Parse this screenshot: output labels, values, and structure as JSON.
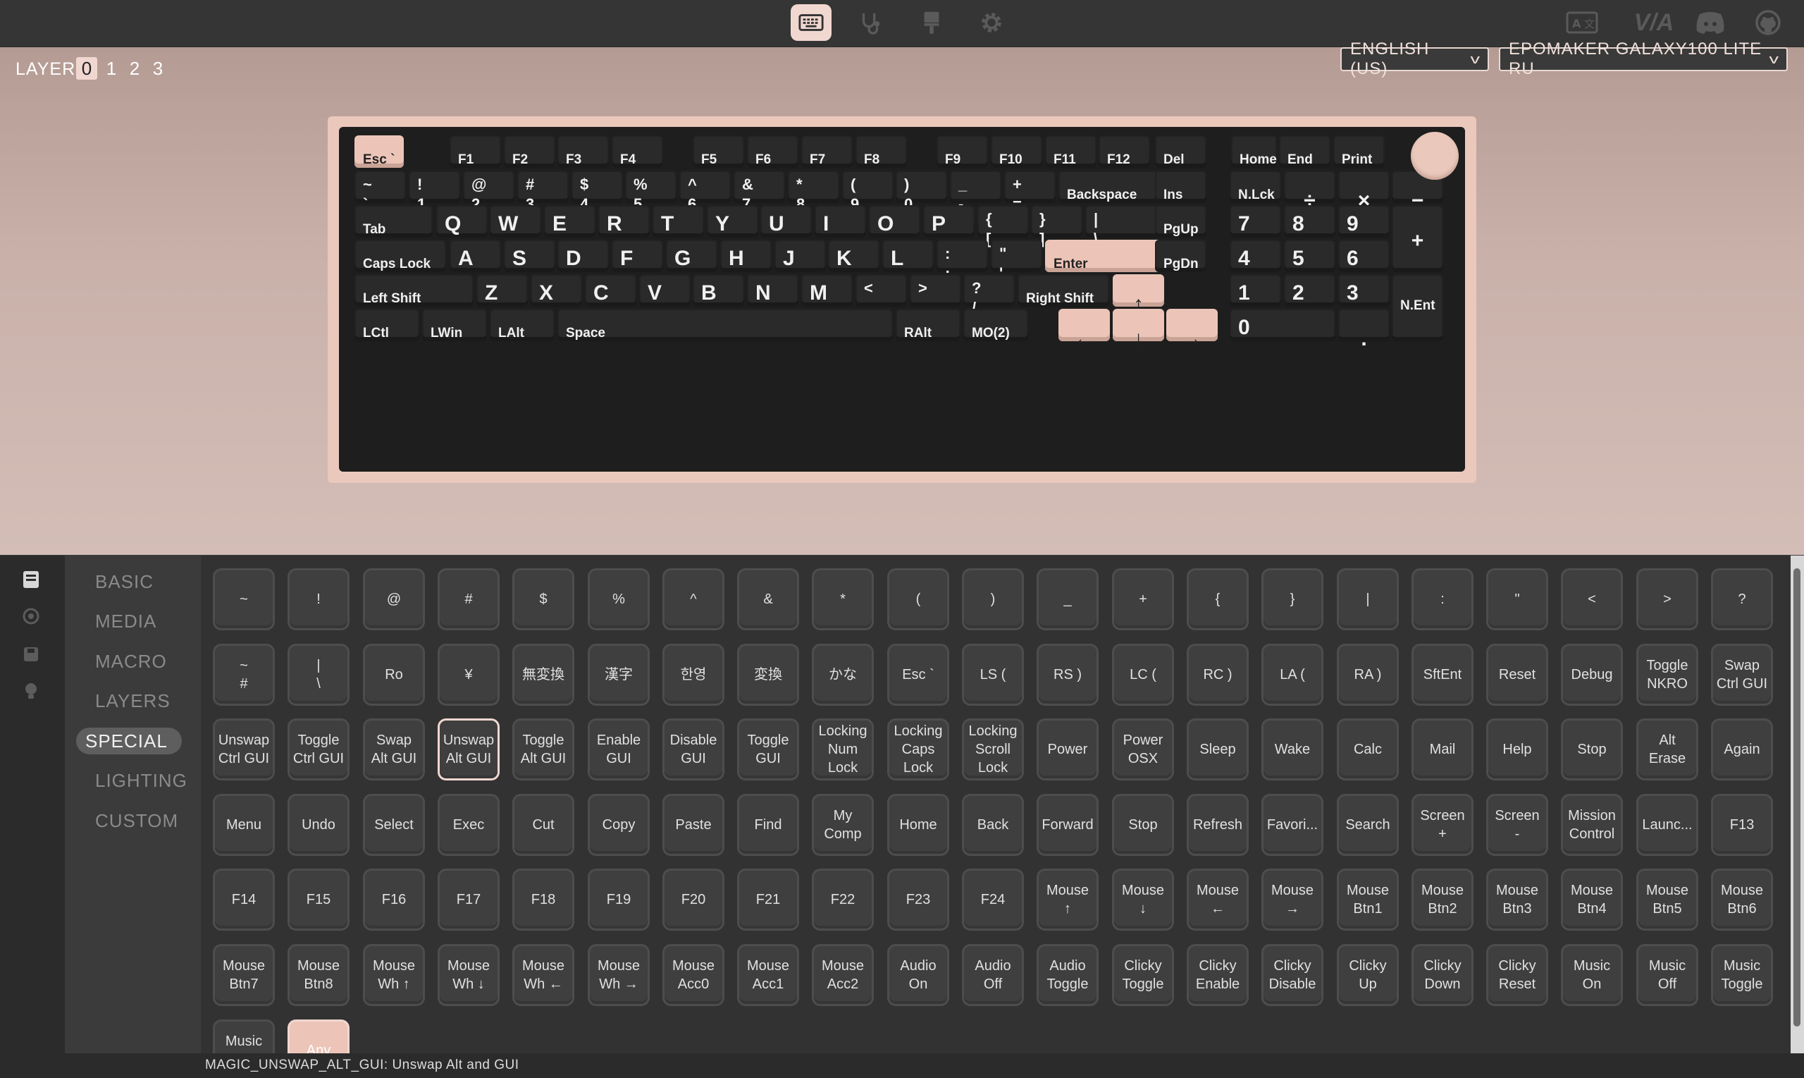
{
  "topbar": {
    "tabs": [
      {
        "icon": "keyboard-icon",
        "active": true
      },
      {
        "icon": "stethoscope-icon",
        "active": false
      },
      {
        "icon": "paint-brush-icon",
        "active": false
      },
      {
        "icon": "gear-icon",
        "active": false
      }
    ],
    "right_icons": [
      "language-icon",
      "via-logo-icon",
      "discord-icon",
      "github-icon"
    ],
    "via_text": "V/A"
  },
  "layers": {
    "label": "LAYER",
    "items": [
      "0",
      "1",
      "2",
      "3"
    ],
    "selected": "0"
  },
  "language_select": {
    "value": "ENGLISH (US)"
  },
  "device_select": {
    "value": "EPOMAKER GALAXY100 LITE RU"
  },
  "keyboard": {
    "rows": {
      "r0": [
        "Esc `",
        "F1",
        "F2",
        "F3",
        "F4",
        "F5",
        "F6",
        "F7",
        "F8",
        "F9",
        "F10",
        "F11",
        "F12",
        "Del",
        "Home",
        "End",
        "Print"
      ],
      "r1": [
        "~\n`",
        "!\n1",
        "@\n2",
        "#\n3",
        "$\n4",
        "%\n5",
        "^\n6",
        "&\n7",
        "*\n8",
        "(\n9",
        ")\n0",
        "_\n-",
        "+\n=",
        "Backspace",
        "Ins",
        "N.Lck",
        "÷",
        "×",
        "−"
      ],
      "r2": [
        "Tab",
        "Q",
        "W",
        "E",
        "R",
        "T",
        "Y",
        "U",
        "I",
        "O",
        "P",
        "{\n[",
        "}\n]",
        "|\n\\",
        "PgUp",
        "7",
        "8",
        "9",
        "+"
      ],
      "r3": [
        "Caps Lock",
        "A",
        "S",
        "D",
        "F",
        "G",
        "H",
        "J",
        "K",
        "L",
        ":\n;",
        "\"\n'",
        "Enter",
        "PgDn",
        "4",
        "5",
        "6"
      ],
      "r4": [
        "Left Shift",
        "Z",
        "X",
        "C",
        "V",
        "B",
        "N",
        "M",
        "<\n,",
        ">\n.",
        "?\n/",
        "Right Shift",
        "↑",
        "1",
        "2",
        "3",
        "N.Ent"
      ],
      "r5": [
        "LCtl",
        "LWin",
        "LAlt",
        "Space",
        "RAlt",
        "MO(2)",
        "←",
        "↓",
        "→",
        "0",
        "."
      ]
    }
  },
  "sidebar": {
    "categories": [
      "BASIC",
      "MEDIA",
      "MACRO",
      "LAYERS",
      "SPECIAL",
      "LIGHTING",
      "CUSTOM"
    ],
    "selected": "SPECIAL"
  },
  "special_keys": [
    "~",
    "!",
    "@",
    "#",
    "$",
    "%",
    "^",
    "&",
    "*",
    "(",
    ")",
    "_",
    "+",
    "{",
    "}",
    "|",
    ":",
    "\"",
    "<",
    ">",
    "?",
    "~\n#",
    "|\n\\",
    "Ro",
    "¥",
    "無変換",
    "漢字",
    "한영",
    "変換",
    "かな",
    "Esc `",
    "LS (",
    "RS )",
    "LC (",
    "RC )",
    "LA (",
    "RA )",
    "SftEnt",
    "Reset",
    "Debug",
    "Toggle\nNKRO",
    "Swap\nCtrl GUI",
    "Unswap\nCtrl GUI",
    "Toggle\nCtrl GUI",
    "Swap\nAlt GUI",
    "Unswap\nAlt GUI",
    "Toggle\nAlt GUI",
    "Enable\nGUI",
    "Disable\nGUI",
    "Toggle\nGUI",
    "Locking\nNum\nLock",
    "Locking\nCaps\nLock",
    "Locking\nScroll\nLock",
    "Power",
    "Power\nOSX",
    "Sleep",
    "Wake",
    "Calc",
    "Mail",
    "Help",
    "Stop",
    "Alt\nErase",
    "Again",
    "Menu",
    "Undo",
    "Select",
    "Exec",
    "Cut",
    "Copy",
    "Paste",
    "Find",
    "My\nComp",
    "Home",
    "Back",
    "Forward",
    "Stop",
    "Refresh",
    "Favori...",
    "Search",
    "Screen\n+",
    "Screen\n-",
    "Mission\nControl",
    "Launc...",
    "F13",
    "F14",
    "F15",
    "F16",
    "F17",
    "F18",
    "F19",
    "F20",
    "F21",
    "F22",
    "F23",
    "F24",
    "Mouse\n↑",
    "Mouse\n↓",
    "Mouse\n←",
    "Mouse\n→",
    "Mouse\nBtn1",
    "Mouse\nBtn2",
    "Mouse\nBtn3",
    "Mouse\nBtn4",
    "Mouse\nBtn5",
    "Mouse\nBtn6",
    "Mouse\nBtn7",
    "Mouse\nBtn8",
    "Mouse\nWh ↑",
    "Mouse\nWh ↓",
    "Mouse\nWh ←",
    "Mouse\nWh →",
    "Mouse\nAcc0",
    "Mouse\nAcc1",
    "Mouse\nAcc2",
    "Audio\nOn",
    "Audio\nOff",
    "Audio\nToggle",
    "Clicky\nToggle",
    "Clicky\nEnable",
    "Clicky\nDisable",
    "Clicky\nUp",
    "Clicky\nDown",
    "Clicky\nReset",
    "Music\nOn",
    "Music\nOff",
    "Music\nToggle",
    "Music\nMode",
    "Any"
  ],
  "selected_special_key": "Unswap\nAlt GUI",
  "status": {
    "text": "MAGIC_UNSWAP_ALT_GUI: Unswap Alt and GUI"
  },
  "colors": {
    "accent": "#ecc5b8",
    "background": "#323232",
    "key": "#2a2a2a"
  }
}
